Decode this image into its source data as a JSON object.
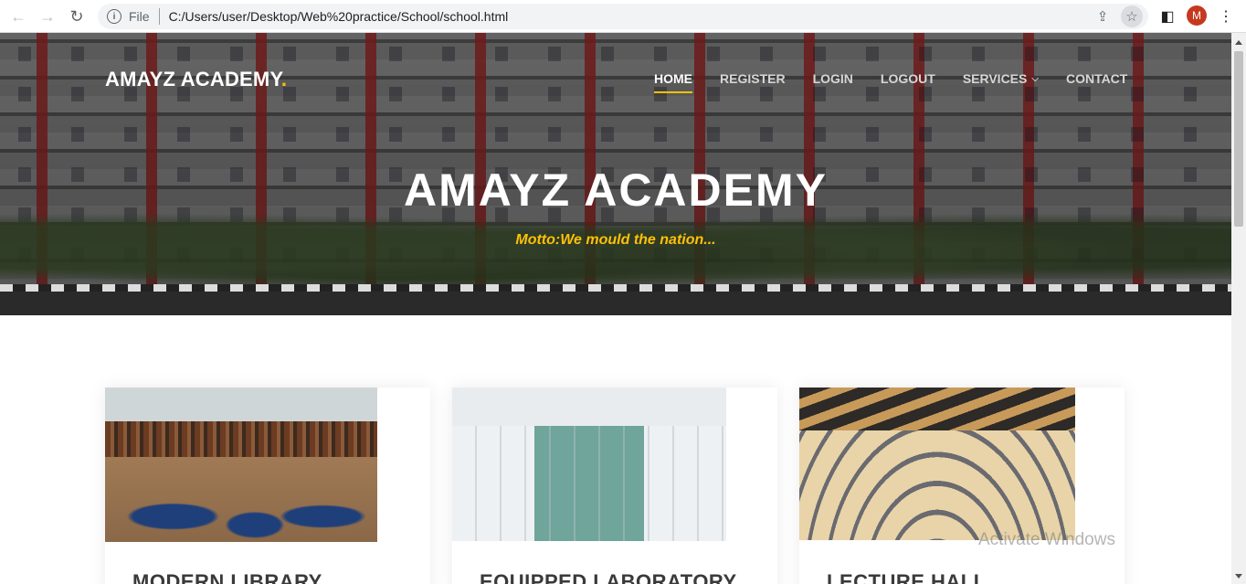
{
  "browser": {
    "back_icon": "←",
    "forward_icon": "→",
    "reload_icon": "↻",
    "info_icon": "i",
    "file_label": "File",
    "url": "C:/Users/user/Desktop/Web%20practice/School/school.html",
    "share_icon": "⇪",
    "star_icon": "☆",
    "sidepanel_icon": "◧",
    "profile_initial": "M",
    "menu_icon": "⋮"
  },
  "site": {
    "logo_text": "AMAYZ ACADEMY",
    "logo_dot": ".",
    "nav": [
      {
        "label": "HOME",
        "active": true
      },
      {
        "label": "REGISTER"
      },
      {
        "label": "LOGIN"
      },
      {
        "label": "LOGOUT"
      },
      {
        "label": "SERVICES",
        "chevron": "⌵"
      },
      {
        "label": "CONTACT"
      }
    ],
    "hero_title": "AMAYZ ACADEMY",
    "hero_motto": "Motto:We mould the nation..."
  },
  "cards": [
    {
      "title": "MODERN LIBRARY"
    },
    {
      "title": "EQUIPPED LABORATORY"
    },
    {
      "title": "LECTURE HALL"
    }
  ],
  "watermark": "Activate Windows",
  "colors": {
    "accent": "#ffc107",
    "profile": "#c5391e"
  }
}
